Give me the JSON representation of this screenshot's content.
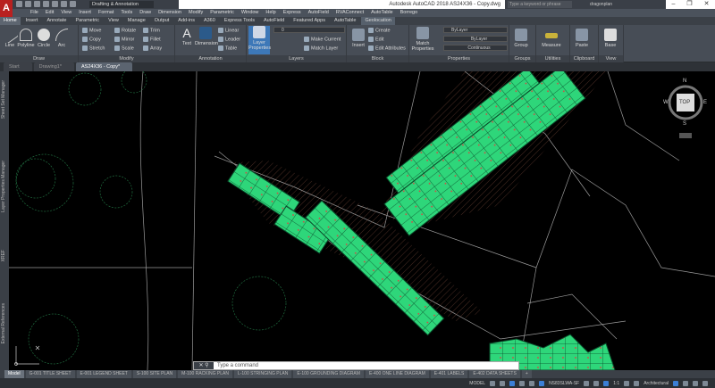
{
  "titlebar": {
    "app_title": "Autodesk AutoCAD 2018   AS24X36 - Copy.dwg",
    "workspace": "Drafting & Annotation",
    "search_placeholder": "Type a keyword or phrase",
    "user": "dragonplan",
    "logo": "A"
  },
  "menu": [
    "File",
    "Edit",
    "View",
    "Insert",
    "Format",
    "Tools",
    "Draw",
    "Dimension",
    "Modify",
    "Parametric",
    "Window",
    "Help",
    "Express",
    "AutoField",
    "RVAConnect",
    "AutoTable",
    "Borrego"
  ],
  "ribbon_tabs": [
    "Home",
    "Insert",
    "Annotate",
    "Parametric",
    "View",
    "Manage",
    "Output",
    "Add-ins",
    "A360",
    "Express Tools",
    "AutoField",
    "Featured Apps",
    "AutoTable",
    "Geolocation"
  ],
  "ribbon": {
    "draw": {
      "label": "Draw",
      "line": "Line",
      "polyline": "Polyline",
      "circle": "Circle",
      "arc": "Arc"
    },
    "modify": {
      "label": "Modify",
      "move": "Move",
      "rotate": "Rotate",
      "trim": "Trim",
      "copy": "Copy",
      "mirror": "Mirror",
      "fillet": "Fillet",
      "stretch": "Stretch",
      "scale": "Scale",
      "array": "Array"
    },
    "annotation": {
      "label": "Annotation",
      "text": "Text",
      "dimension": "Dimension",
      "linear": "Linear",
      "leader": "Leader",
      "table": "Table"
    },
    "layers": {
      "label": "Layers",
      "layer_properties": "Layer Properties",
      "current_layer": "0",
      "make_current": "Make Current",
      "match_layer": "Match Layer"
    },
    "block": {
      "label": "Block",
      "insert": "Insert",
      "create": "Create",
      "edit": "Edit",
      "edit_attributes": "Edit Attributes"
    },
    "properties": {
      "label": "Properties",
      "match_properties": "Match Properties",
      "color": "ByLayer",
      "lineweight": "ByLayer",
      "linetype": "Continuous"
    },
    "groups": {
      "label": "Groups",
      "group": "Group"
    },
    "utilities": {
      "label": "Utilities",
      "measure": "Measure"
    },
    "clipboard": {
      "label": "Clipboard",
      "paste": "Paste"
    },
    "view": {
      "label": "View",
      "base": "Base"
    }
  },
  "doc_tabs": [
    "Start",
    "Drawing1*",
    "AS24X36 - Copy*"
  ],
  "side_palettes": [
    "Sheet Set Manager",
    "Layer Properties Manager",
    "XREF",
    "External References"
  ],
  "viewcube": {
    "top": "TOP",
    "n": "N",
    "s": "S",
    "e": "E",
    "w": "W"
  },
  "command_line": {
    "placeholder": "Type a command",
    "prompt": "▸"
  },
  "layout_tabs": [
    "Model",
    "G-001 TITLE SHEET",
    "E-001 LEGEND SHEET",
    "S-100 SITE PLAN",
    "M-100 RACKING PLAN",
    "L-100 STRINGING PLAN",
    "E-100 GROUNDING DIAGRAM",
    "E-400 ONE LINE DIAGRAM",
    "E-401 LABELS",
    "E-402 DATA SHEETS"
  ],
  "status": {
    "mode": "MODEL",
    "coord_system": "NS83SLWA-SF",
    "scale": "1:1",
    "units": "Architectural"
  },
  "colors": {
    "panel_fill": "#2ed67a",
    "canvas": "#000000",
    "accent": "#3c7fd6"
  }
}
